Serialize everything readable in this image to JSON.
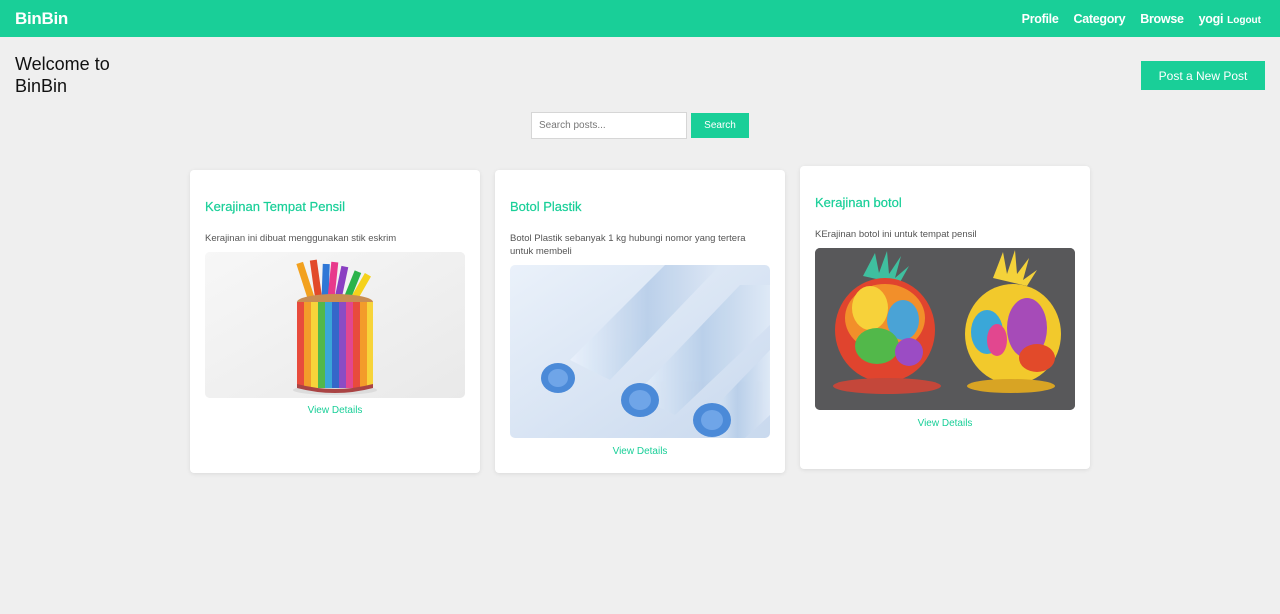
{
  "navbar": {
    "brand": "BinBin",
    "links": [
      "Profile",
      "Category",
      "Browse"
    ],
    "username": "yogi",
    "logout": "Logout"
  },
  "header": {
    "welcome": "Welcome to BinBin",
    "post_button": "Post a New Post"
  },
  "search": {
    "placeholder": "Search posts...",
    "button": "Search"
  },
  "posts": [
    {
      "title": "Kerajinan Tempat Pensil",
      "description": "Kerajinan ini dibuat menggunakan stik eskrim",
      "link": "View Details"
    },
    {
      "title": "Botol Plastik",
      "description": "Botol Plastik sebanyak 1 kg hubungi nomor yang tertera untuk membeli",
      "link": "View Details"
    },
    {
      "title": "Kerajinan botol",
      "description": "KErajinan botol ini untuk tempat pensil",
      "link": "View Details"
    }
  ],
  "colors": {
    "accent": "#19cf98",
    "background": "#efefef"
  }
}
